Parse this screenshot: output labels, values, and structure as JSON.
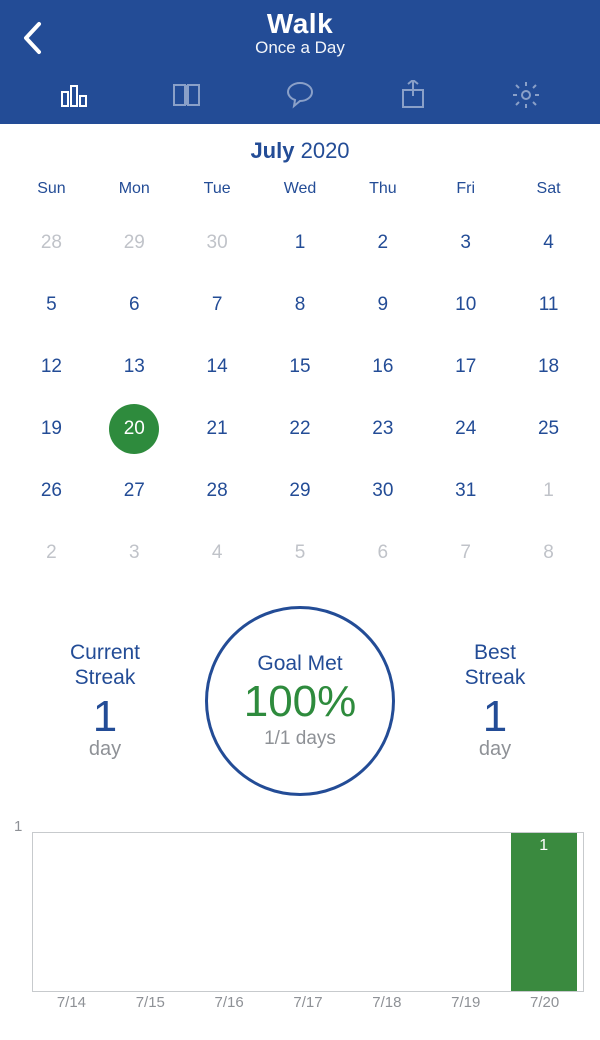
{
  "header": {
    "title": "Walk",
    "subtitle": "Once a Day"
  },
  "tabs": {
    "active_index": 0,
    "items": [
      "stats",
      "journal",
      "comment",
      "share",
      "settings"
    ]
  },
  "calendar": {
    "month": "July",
    "year": "2020",
    "dow": [
      "Sun",
      "Mon",
      "Tue",
      "Wed",
      "Thu",
      "Fri",
      "Sat"
    ],
    "cells": [
      {
        "n": "28",
        "out": true
      },
      {
        "n": "29",
        "out": true
      },
      {
        "n": "30",
        "out": true
      },
      {
        "n": "1"
      },
      {
        "n": "2"
      },
      {
        "n": "3"
      },
      {
        "n": "4"
      },
      {
        "n": "5"
      },
      {
        "n": "6"
      },
      {
        "n": "7"
      },
      {
        "n": "8"
      },
      {
        "n": "9"
      },
      {
        "n": "10"
      },
      {
        "n": "11"
      },
      {
        "n": "12"
      },
      {
        "n": "13"
      },
      {
        "n": "14"
      },
      {
        "n": "15"
      },
      {
        "n": "16"
      },
      {
        "n": "17"
      },
      {
        "n": "18"
      },
      {
        "n": "19"
      },
      {
        "n": "20",
        "sel": true
      },
      {
        "n": "21"
      },
      {
        "n": "22"
      },
      {
        "n": "23"
      },
      {
        "n": "24"
      },
      {
        "n": "25"
      },
      {
        "n": "26"
      },
      {
        "n": "27"
      },
      {
        "n": "28"
      },
      {
        "n": "29"
      },
      {
        "n": "30"
      },
      {
        "n": "31"
      },
      {
        "n": "1",
        "out": true
      },
      {
        "n": "2",
        "out": true
      },
      {
        "n": "3",
        "out": true
      },
      {
        "n": "4",
        "out": true
      },
      {
        "n": "5",
        "out": true
      },
      {
        "n": "6",
        "out": true
      },
      {
        "n": "7",
        "out": true
      },
      {
        "n": "8",
        "out": true
      }
    ]
  },
  "stats": {
    "current_label_l1": "Current",
    "current_label_l2": "Streak",
    "current_value": "1",
    "current_unit": "day",
    "goal_label": "Goal Met",
    "goal_pct": "100%",
    "goal_days": "1/1 days",
    "best_label_l1": "Best",
    "best_label_l2": "Streak",
    "best_value": "1",
    "best_unit": "day"
  },
  "chart_data": {
    "type": "bar",
    "categories": [
      "7/14",
      "7/15",
      "7/16",
      "7/17",
      "7/18",
      "7/19",
      "7/20"
    ],
    "values": [
      0,
      0,
      0,
      0,
      0,
      0,
      1
    ],
    "title": "",
    "xlabel": "",
    "ylabel": "",
    "ylim": [
      0,
      1
    ],
    "ytick": "1",
    "bar_color": "#3a8a3f"
  }
}
